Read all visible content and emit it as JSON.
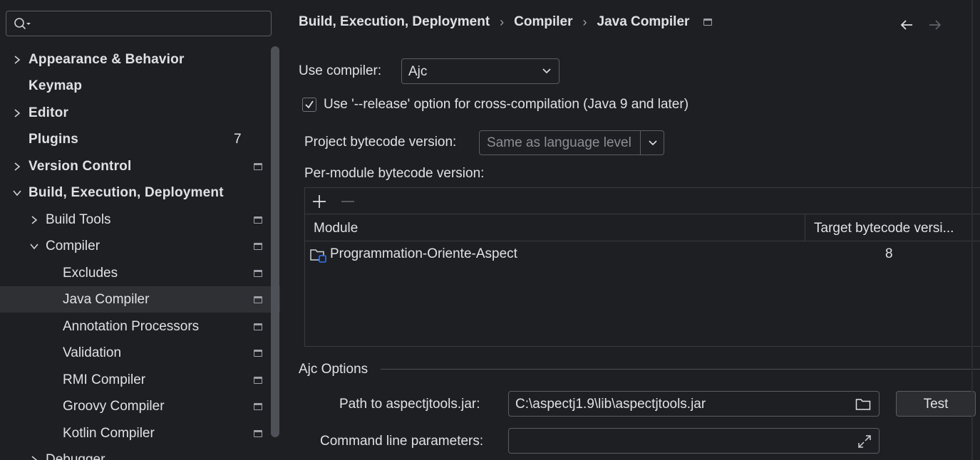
{
  "search": {
    "placeholder": ""
  },
  "tree": {
    "items": [
      {
        "label": "Appearance & Behavior",
        "expandable": true,
        "expanded": false
      },
      {
        "label": "Keymap"
      },
      {
        "label": "Editor",
        "expandable": true,
        "expanded": false
      },
      {
        "label": "Plugins",
        "badge": "7"
      },
      {
        "label": "Version Control",
        "expandable": true,
        "expanded": false
      },
      {
        "label": "Build, Execution, Deployment",
        "expandable": true,
        "expanded": true
      },
      {
        "label": "Build Tools",
        "expandable": true,
        "expanded": false
      },
      {
        "label": "Compiler",
        "expandable": true,
        "expanded": true
      },
      {
        "label": "Excludes"
      },
      {
        "label": "Java Compiler",
        "selected": true
      },
      {
        "label": "Annotation Processors"
      },
      {
        "label": "Validation"
      },
      {
        "label": "RMI Compiler"
      },
      {
        "label": "Groovy Compiler"
      },
      {
        "label": "Kotlin Compiler"
      },
      {
        "label": "Debugger",
        "expandable": true,
        "expanded": false
      }
    ]
  },
  "breadcrumb": {
    "items": [
      "Build, Execution, Deployment",
      "Compiler",
      "Java Compiler"
    ],
    "separator": "›"
  },
  "compiler": {
    "label": "Use compiler:",
    "value": "Ajc"
  },
  "release_option": {
    "label": "Use '--release' option for cross-compilation (Java 9 and later)",
    "checked": true
  },
  "bytecode": {
    "label": "Project bytecode version:",
    "placeholder": "Same as language level"
  },
  "per_module": {
    "label": "Per-module bytecode version:",
    "columns": [
      "Module",
      "Target bytecode versi..."
    ],
    "rows": [
      {
        "module": "Programmation-Oriente-Aspect",
        "target": "8"
      }
    ]
  },
  "ajc": {
    "title": "Ajc Options",
    "path_label": "Path to aspectjtools.jar:",
    "path_value": "C:\\aspectj1.9\\lib\\aspectjtools.jar",
    "test_label": "Test",
    "cmd_label": "Command line parameters:",
    "cmd_value": ""
  },
  "colors": {
    "background": "#1e1f22",
    "selection": "#2e3033",
    "text": "#dfe1e5",
    "module_icon_accent": "#3574f0"
  }
}
